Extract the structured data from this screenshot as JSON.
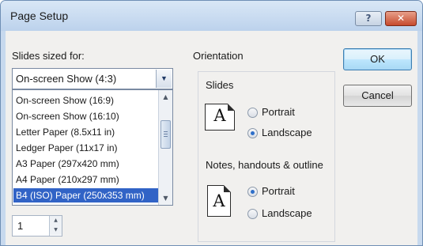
{
  "window": {
    "title": "Page Setup",
    "help_label": "?",
    "close_label": "✕"
  },
  "slides_sized_for": {
    "label": "Slides sized for:",
    "selected_value": "On-screen Show (4:3)",
    "options": [
      "On-screen Show (16:9)",
      "On-screen Show (16:10)",
      "Letter Paper (8.5x11 in)",
      "Ledger Paper (11x17 in)",
      "A3 Paper (297x420 mm)",
      "A4 Paper (210x297 mm)",
      "B4 (ISO) Paper (250x353 mm)"
    ],
    "highlighted_option": "B4 (ISO) Paper (250x353 mm)"
  },
  "number_slides_from": {
    "value": "1"
  },
  "orientation": {
    "title": "Orientation",
    "slides": {
      "label": "Slides",
      "icon_letter": "A",
      "portrait_label": "Portrait",
      "landscape_label": "Landscape",
      "selected": "Landscape"
    },
    "notes": {
      "label": "Notes, handouts & outline",
      "icon_letter": "A",
      "portrait_label": "Portrait",
      "landscape_label": "Landscape",
      "selected": "Portrait"
    }
  },
  "buttons": {
    "ok": "OK",
    "cancel": "Cancel"
  }
}
